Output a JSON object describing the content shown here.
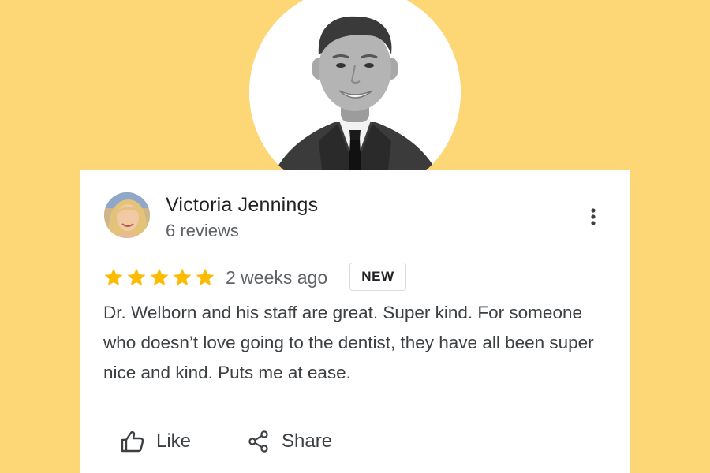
{
  "review": {
    "reviewer_name": "Victoria Jennings",
    "reviewer_reviews": "6 reviews",
    "rating": 5,
    "rating_max": 5,
    "time_ago": "2 weeks ago",
    "badge": "NEW",
    "text": "Dr. Welborn and his staff are great. Super kind. For someone who doesn’t love going to the dentist, they have all been super nice and kind. Puts me at ease."
  },
  "actions": {
    "like_label": "Like",
    "share_label": "Share"
  },
  "icons": {
    "more": "more-vert-icon",
    "like": "thumb-up-icon",
    "share": "share-icon",
    "star": "star-icon"
  },
  "colors": {
    "background": "#FDD676",
    "card": "#ffffff",
    "star": "#FBBC04",
    "name_text": "#202124",
    "secondary_text": "#5f6368"
  }
}
